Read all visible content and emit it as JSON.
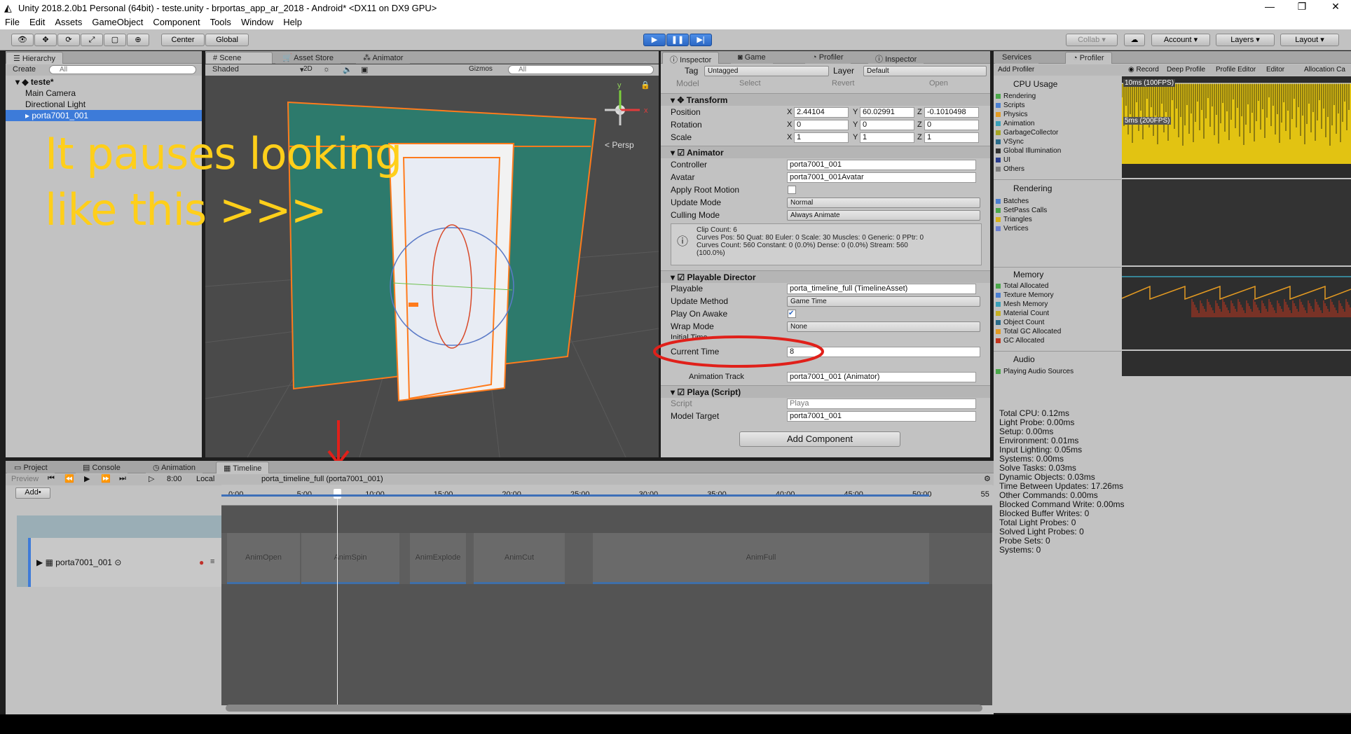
{
  "window": {
    "title": "Unity 2018.2.0b1 Personal (64bit) - teste.unity - brportas_app_ar_2018 - Android* <DX11 on DX9 GPU>"
  },
  "menu": [
    "File",
    "Edit",
    "Assets",
    "GameObject",
    "Component",
    "Tools",
    "Window",
    "Help"
  ],
  "toolbar": {
    "center": "Center",
    "global": "Global",
    "collab": "Collab",
    "account": "Account",
    "layers": "Layers",
    "layout": "Layout"
  },
  "hierarchy": {
    "tab": "Hierarchy",
    "create": "Create",
    "search_placeholder": "All",
    "scene": "teste*",
    "items": [
      "Main Camera",
      "Directional Light",
      "porta7001_001"
    ]
  },
  "scene": {
    "tabs": [
      "Scene",
      "Asset Store",
      "Animator"
    ],
    "shading": "Shaded",
    "mode2d": "2D",
    "gizmos": "Gizmos",
    "search_placeholder": "All",
    "persp": "Persp",
    "annotation_line1": "It pauses looking",
    "annotation_line2": "like this >>>"
  },
  "inspector": {
    "tabs": [
      "Inspector",
      "Game",
      "Profiler",
      "Inspector"
    ],
    "tag_label": "Tag",
    "tag": "Untagged",
    "layer_label": "Layer",
    "layer": "Default",
    "model_label": "Model",
    "select": "Select",
    "revert": "Revert",
    "open": "Open",
    "transform": {
      "title": "Transform",
      "position": "Position",
      "rotation": "Rotation",
      "scale": "Scale",
      "px": "2.44104",
      "py": "60.02991",
      "pz": "-0.1010498",
      "rx": "0",
      "ry": "0",
      "rz": "0",
      "sx": "1",
      "sy": "1",
      "sz": "1"
    },
    "animator": {
      "title": "Animator",
      "controller_label": "Controller",
      "controller": "porta7001_001",
      "avatar_label": "Avatar",
      "avatar": "porta7001_001Avatar",
      "apply_root": "Apply Root Motion",
      "update_mode_label": "Update Mode",
      "update_mode": "Normal",
      "culling_label": "Culling Mode",
      "culling": "Always Animate",
      "info1": "Clip Count: 6",
      "info2": "Curves Pos: 50 Quat: 80 Euler: 0 Scale: 30 Muscles: 0 Generic: 0 PPtr: 0",
      "info3": "Curves Count: 560 Constant: 0 (0.0%) Dense: 0 (0.0%) Stream: 560",
      "info4": "(100.0%)"
    },
    "director": {
      "title": "Playable Director",
      "playable_label": "Playable",
      "playable": "porta_timeline_full (TimelineAsset)",
      "update_label": "Update Method",
      "update": "Game Time",
      "play_on_awake": "Play On Awake",
      "wrap_label": "Wrap Mode",
      "wrap": "None",
      "initial_label": "Initial Time",
      "current_label": "Current Time",
      "current": "8",
      "track": "Animation Track",
      "track_value": "porta7001_001 (Animator)"
    },
    "playa": {
      "title": "Playa (Script)",
      "script_label": "Script",
      "script": "Playa",
      "model_label": "Model Target",
      "model": "porta7001_001"
    },
    "add_component": "Add Component"
  },
  "profiler": {
    "tabs": [
      "Services",
      "Profiler"
    ],
    "add_profiler": "Add Profiler",
    "record": "Record",
    "deep": "Deep Profile",
    "editor_btn": "Profile Editor",
    "editor": "Editor",
    "alloc": "Allocation Ca",
    "cpu": {
      "title": "CPU Usage",
      "items": [
        "Rendering",
        "Scripts",
        "Physics",
        "Animation",
        "GarbageCollector",
        "VSync",
        "Global Illumination",
        "UI",
        "Others"
      ],
      "label_10ms": "10ms (100FPS)",
      "label_5ms": "5ms (200FPS)"
    },
    "rendering": {
      "title": "Rendering",
      "items": [
        "Batches",
        "SetPass Calls",
        "Triangles",
        "Vertices"
      ]
    },
    "memory": {
      "title": "Memory",
      "items": [
        "Total Allocated",
        "Texture Memory",
        "Mesh Memory",
        "Material Count",
        "Object Count",
        "Total GC Allocated",
        "GC Allocated"
      ]
    },
    "audio": {
      "title": "Audio",
      "items": [
        "Playing Audio Sources"
      ]
    },
    "stats": [
      "Total CPU: 0.12ms",
      "Light Probe: 0.00ms",
      "Setup: 0.00ms",
      "Environment: 0.01ms",
      "Input Lighting: 0.05ms",
      "Systems: 0.00ms",
      "Solve Tasks: 0.03ms",
      "Dynamic Objects: 0.03ms",
      "Time Between Updates: 17.26ms",
      "Other Commands: 0.00ms",
      "Blocked Command Write: 0.00ms",
      "Blocked Buffer Writes: 0",
      "Total Light Probes: 0",
      "Solved Light Probes: 0",
      "Probe Sets: 0",
      "Systems: 0"
    ]
  },
  "timeline": {
    "tabs": [
      "Project",
      "Console",
      "Animation",
      "Timeline"
    ],
    "preview": "Preview",
    "frame": "8:00",
    "local": "Local",
    "asset": "porta_timeline_full (porta7001_001)",
    "add": "Add•",
    "ticks": [
      "0:00",
      "5:00",
      "10:00",
      "15:00",
      "20:00",
      "25:00",
      "30:00",
      "35:00",
      "40:00",
      "45:00",
      "50:00",
      "55"
    ],
    "track": "porta7001_001",
    "clips": [
      "AnimOpen",
      "AnimSpin",
      "AnimExplode",
      "AnimCut",
      "AnimFull"
    ]
  }
}
